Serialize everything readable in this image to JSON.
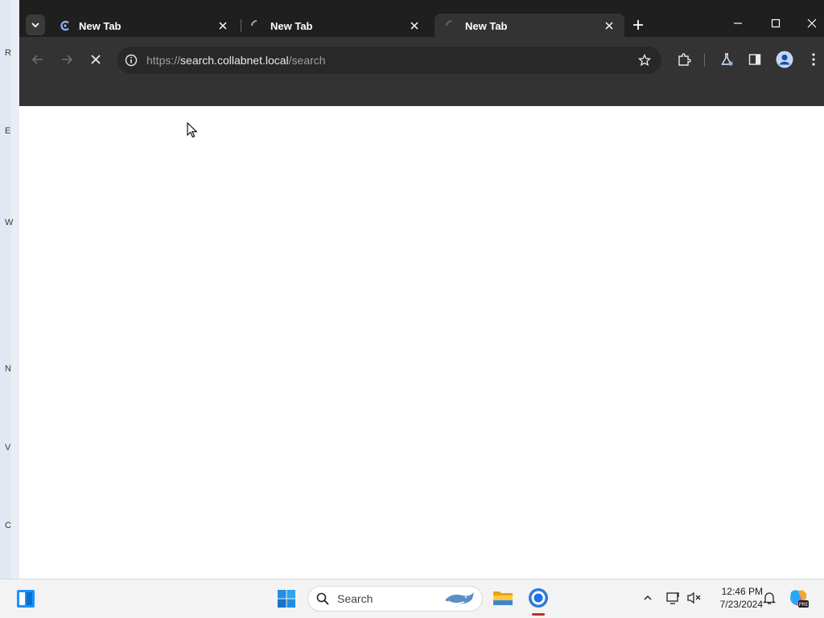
{
  "desktop": {
    "edge_letters": [
      "R",
      "E",
      "W",
      "N",
      "V",
      "C"
    ]
  },
  "browser": {
    "tabs": [
      {
        "title": "New Tab",
        "favicon": "collab-logo-icon",
        "active": false
      },
      {
        "title": "New Tab",
        "favicon": "loading-spinner-icon",
        "active": false
      },
      {
        "title": "New Tab",
        "favicon": "loading-spinner-icon",
        "active": true
      }
    ],
    "omnibox": {
      "url_scheme": "https://",
      "url_host": "search.collabnet.local",
      "url_path": "/search"
    },
    "icons": {
      "back": "arrow-left-icon",
      "forward": "arrow-right-icon",
      "stop": "close-icon",
      "site_info": "info-icon",
      "bookmark": "star-icon",
      "extensions": "puzzle-icon",
      "labs": "flask-icon",
      "side_panel": "side-panel-icon",
      "profile": "profile-icon",
      "menu": "kebab-menu-icon"
    },
    "colors": {
      "titlebar": "#1f1f1f",
      "toolbar": "#333333",
      "omnibox": "#282828",
      "accent": "#8ab4f8"
    }
  },
  "taskbar": {
    "search_placeholder": "Search",
    "clock_time": "12:46 PM",
    "clock_date": "7/23/2024"
  }
}
